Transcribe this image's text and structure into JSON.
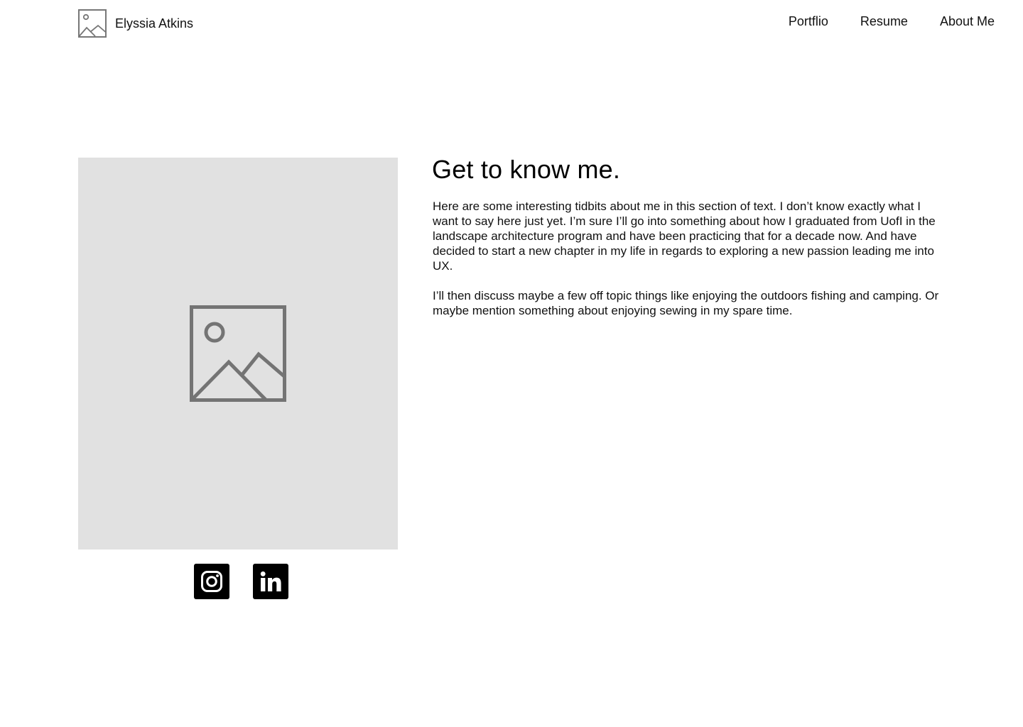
{
  "header": {
    "brand_name": "Elyssia Atkins",
    "logo_icon": "image-placeholder-icon"
  },
  "nav": {
    "items": [
      {
        "label": "Portflio"
      },
      {
        "label": "Resume"
      },
      {
        "label": "About Me"
      }
    ]
  },
  "hero": {
    "image_icon": "image-placeholder-icon",
    "placeholder_color": "#e1e1e1"
  },
  "about": {
    "heading": "Get to know me.",
    "paragraphs": [
      "Here are some interesting tidbits about me in this section of text. I don’t know exactly what I want to say here just yet. I’m sure I’ll go into something about how I graduated from UofI in the landscape architecture program and have been practicing that for a decade now. And have decided to start a new chapter in my life in regards to exploring a new passion leading me into UX.",
      "I’ll then discuss maybe a few off topic things like enjoying the outdoors fishing and camping. Or maybe mention something about enjoying sewing in my spare time."
    ]
  },
  "socials": {
    "items": [
      {
        "icon": "instagram-icon"
      },
      {
        "icon": "linkedin-icon"
      }
    ]
  }
}
